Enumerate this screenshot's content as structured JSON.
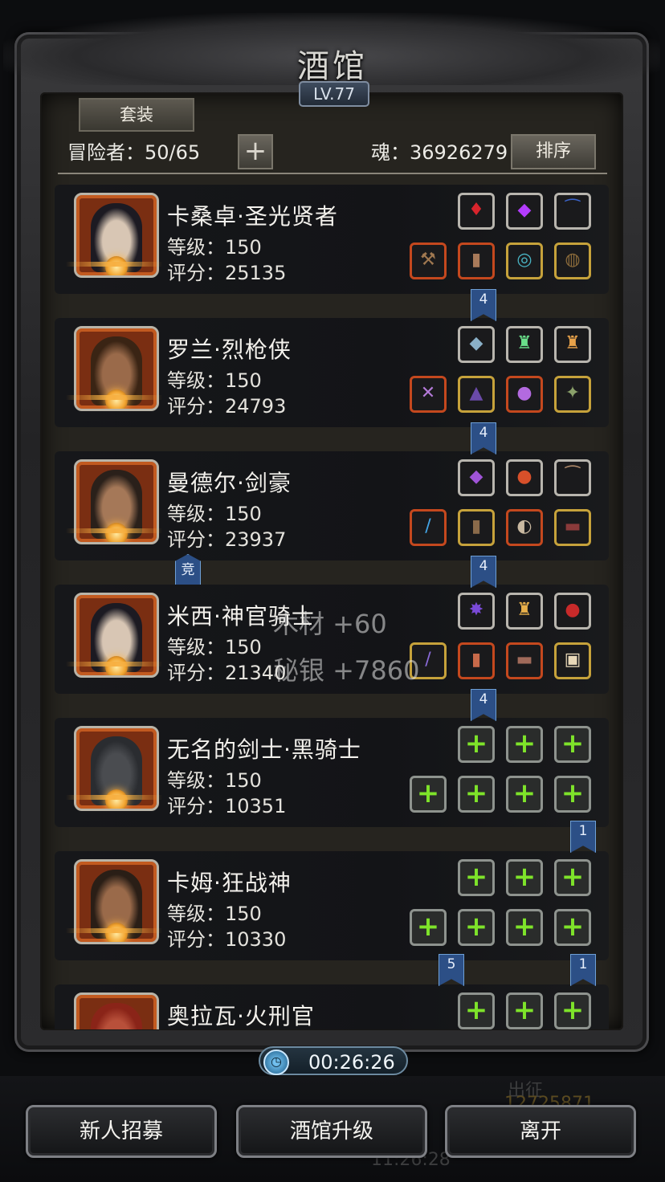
{
  "header": {
    "title": "酒馆",
    "level": "LV.77",
    "suit_button": "套装",
    "adventurers": "冒险者：50/65",
    "add_symbol": "+",
    "soul": "魂：36926279",
    "sort_button": "排序"
  },
  "heroes": [
    {
      "name": "卡桑卓·圣光贤者",
      "level": "等级：150",
      "score": "评分：25135",
      "skin": "#d8c6b4",
      "hair": "#1c1a22",
      "top_slots": [
        {
          "frame": "w",
          "icon": "♦",
          "color": "#d8242c"
        },
        {
          "frame": "w",
          "icon": "◆",
          "color": "#b43cff"
        },
        {
          "frame": "w",
          "icon": "⁀",
          "color": "#3a62c8"
        }
      ],
      "bottom_slots": [
        {
          "frame": "r",
          "icon": "⚒",
          "color": "#a07850"
        },
        {
          "frame": "r",
          "icon": "▮",
          "color": "#a87a5a"
        },
        {
          "frame": "y",
          "icon": "◎",
          "color": "#4ab6c6"
        },
        {
          "frame": "y",
          "icon": "◍",
          "color": "#8a6a3a"
        }
      ]
    },
    {
      "name": "罗兰·烈枪侠",
      "level": "等级：150",
      "score": "评分：24793",
      "skin": "#9a6a4a",
      "hair": "#3a2414",
      "top_slots": [
        {
          "frame": "w",
          "icon": "◆",
          "color": "#8ab0c8"
        },
        {
          "frame": "w",
          "icon": "♜",
          "color": "#6ae08a"
        },
        {
          "frame": "w",
          "icon": "♜",
          "color": "#e8a24a"
        }
      ],
      "bottom_slots": [
        {
          "frame": "r",
          "icon": "✕",
          "color": "#b47ad8"
        },
        {
          "frame": "y",
          "icon": "▲",
          "color": "#6a4aa8"
        },
        {
          "frame": "r",
          "icon": "●",
          "color": "#b36ae0"
        },
        {
          "frame": "y",
          "icon": "✦",
          "color": "#8aa06a"
        }
      ]
    },
    {
      "name": "曼德尔·剑豪",
      "level": "等级：150",
      "score": "评分：23937",
      "skin": "#a57858",
      "hair": "#2a201a",
      "badge": "竞",
      "top_slots": [
        {
          "frame": "w",
          "icon": "◆",
          "color": "#a054d8"
        },
        {
          "frame": "w",
          "icon": "●",
          "color": "#d8502a"
        },
        {
          "frame": "w",
          "icon": "⁀",
          "color": "#b08a6a"
        }
      ],
      "bottom_slots": [
        {
          "frame": "r",
          "icon": "/",
          "color": "#44a6e8"
        },
        {
          "frame": "y",
          "icon": "▮",
          "color": "#8a6a4a"
        },
        {
          "frame": "r",
          "icon": "◐",
          "color": "#c8b8a0"
        },
        {
          "frame": "y",
          "icon": "▬",
          "color": "#8a3a3a"
        }
      ]
    },
    {
      "name": "米西·神官骑士",
      "level": "等级：150",
      "score": "评分：21340",
      "skin": "#d8c6b4",
      "hair": "#1c1a22",
      "top_slots": [
        {
          "frame": "w",
          "icon": "✸",
          "color": "#7a4ad8"
        },
        {
          "frame": "w",
          "icon": "♜",
          "color": "#e8b04a"
        },
        {
          "frame": "w",
          "icon": "●",
          "color": "#c82a2a"
        }
      ],
      "bottom_slots": [
        {
          "frame": "y",
          "icon": "/",
          "color": "#8a6ad8"
        },
        {
          "frame": "r",
          "icon": "▮",
          "color": "#c86a4a"
        },
        {
          "frame": "r",
          "icon": "▬",
          "color": "#a06a5a"
        },
        {
          "frame": "y",
          "icon": "▣",
          "color": "#e8d8b8"
        }
      ]
    },
    {
      "name": "无名的剑士·黑骑士",
      "level": "等级：150",
      "score": "评分：10351",
      "skin": "#4a4c50",
      "hair": "#2a2c30",
      "empty": true
    },
    {
      "name": "卡姆·狂战神",
      "level": "等级：150",
      "score": "评分：10330",
      "skin": "#9a6a4a",
      "hair": "#2a1e16",
      "empty": true
    },
    {
      "name": "奥拉瓦·火刑官",
      "level": "",
      "score": "",
      "skin": "#b8503a",
      "hair": "#8a2418",
      "empty": true
    }
  ],
  "ribbons": [
    "4",
    "4",
    "4",
    "4",
    "1",
    "5",
    "1"
  ],
  "floating": {
    "wood": "木材 +60",
    "silver": "秘银 +7860"
  },
  "timer": "00:26:26",
  "background": {
    "expedition": "出征",
    "gold": "12725871",
    "clock": "11:26:28"
  },
  "buttons": {
    "recruit": "新人招募",
    "upgrade": "酒馆升级",
    "leave": "离开"
  }
}
